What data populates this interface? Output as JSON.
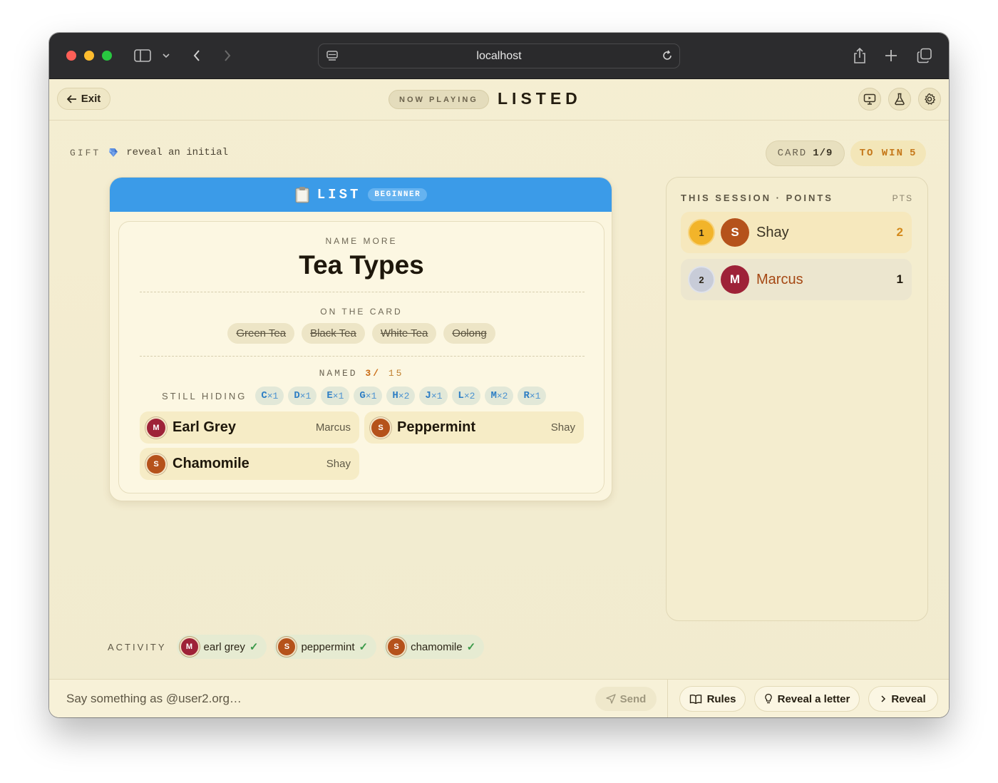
{
  "browser": {
    "url": "localhost"
  },
  "header": {
    "exit_label": "Exit",
    "now_playing": "NOW PLAYING",
    "title": "LISTED"
  },
  "gift": {
    "label": "GIFT",
    "text": "reveal an initial"
  },
  "status": {
    "card_label": "CARD",
    "card_value": "1/9",
    "win_label": "TO WIN",
    "win_value": "5"
  },
  "card": {
    "header_label": "LIST",
    "level": "BEGINNER",
    "prompt": "NAME MORE",
    "topic": "Tea Types",
    "on_card_label": "ON THE CARD",
    "on_card": [
      "Green Tea",
      "Black Tea",
      "White Tea",
      "Oolong"
    ],
    "named_label": "NAMED",
    "named_count": "3/",
    "named_total": "15",
    "still_hiding_label": "STILL HIDING",
    "hiding": [
      {
        "letter": "C",
        "count": "×1"
      },
      {
        "letter": "D",
        "count": "×1"
      },
      {
        "letter": "E",
        "count": "×1"
      },
      {
        "letter": "G",
        "count": "×1"
      },
      {
        "letter": "H",
        "count": "×2"
      },
      {
        "letter": "J",
        "count": "×1"
      },
      {
        "letter": "L",
        "count": "×2"
      },
      {
        "letter": "M",
        "count": "×2"
      },
      {
        "letter": "R",
        "count": "×1"
      }
    ],
    "answers": [
      {
        "initial": "M",
        "answer": "Earl Grey",
        "player": "Marcus"
      },
      {
        "initial": "S",
        "answer": "Peppermint",
        "player": "Shay"
      },
      {
        "initial": "S",
        "answer": "Chamomile",
        "player": "Shay"
      }
    ]
  },
  "session": {
    "title": "THIS SESSION · POINTS",
    "pts_label": "PTS",
    "players": [
      {
        "rank": "1",
        "initial": "S",
        "name": "Shay",
        "score": "2"
      },
      {
        "rank": "2",
        "initial": "M",
        "name": "Marcus",
        "score": "1"
      }
    ]
  },
  "activity": {
    "label": "ACTIVITY",
    "items": [
      {
        "initial": "M",
        "text": "earl grey",
        "check": "✓"
      },
      {
        "initial": "S",
        "text": "peppermint",
        "check": "✓"
      },
      {
        "initial": "S",
        "text": "chamomile",
        "check": "✓"
      }
    ]
  },
  "bottom": {
    "chat_placeholder": "Say something as @user2.org…",
    "send_label": "Send",
    "rules_label": "Rules",
    "reveal_letter_label": "Reveal a letter",
    "reveal_label": "Reveal"
  },
  "colors": {
    "accent_blue": "#3b9be8",
    "marcus": "#9e2238",
    "shay": "#b5521b",
    "gold": "#f2b42a"
  }
}
